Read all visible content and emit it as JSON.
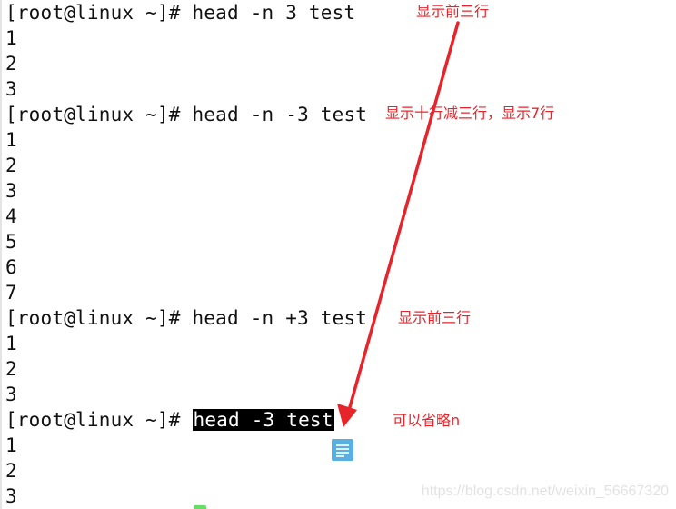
{
  "terminal": {
    "blocks": [
      {
        "prompt": "[root@linux ~]# ",
        "command": "head -n 3 test",
        "output": [
          "1",
          "2",
          "3"
        ]
      },
      {
        "prompt": "[root@linux ~]# ",
        "command": "head -n -3 test",
        "output": [
          "1",
          "2",
          "3",
          "4",
          "5",
          "6",
          "7"
        ]
      },
      {
        "prompt": "[root@linux ~]# ",
        "command": "head -n +3 test",
        "output": [
          "1",
          "2",
          "3"
        ]
      },
      {
        "prompt": "[root@linux ~]# ",
        "command": "head -3 test",
        "command_highlighted": true,
        "output": [
          "1",
          "2",
          "3"
        ]
      }
    ]
  },
  "annotations": {
    "top_note": "显示前三行",
    "note_minus_three": "显示十行减三行，显示7行",
    "note_plus_three": "显示前三行",
    "note_omit_n": "可以省略n",
    "color": "#e8242b"
  },
  "icons": {
    "floating_doc": "document-icon",
    "arrow": "red-arrow"
  },
  "watermark": "https://blog.csdn.net/weixin_56667320"
}
